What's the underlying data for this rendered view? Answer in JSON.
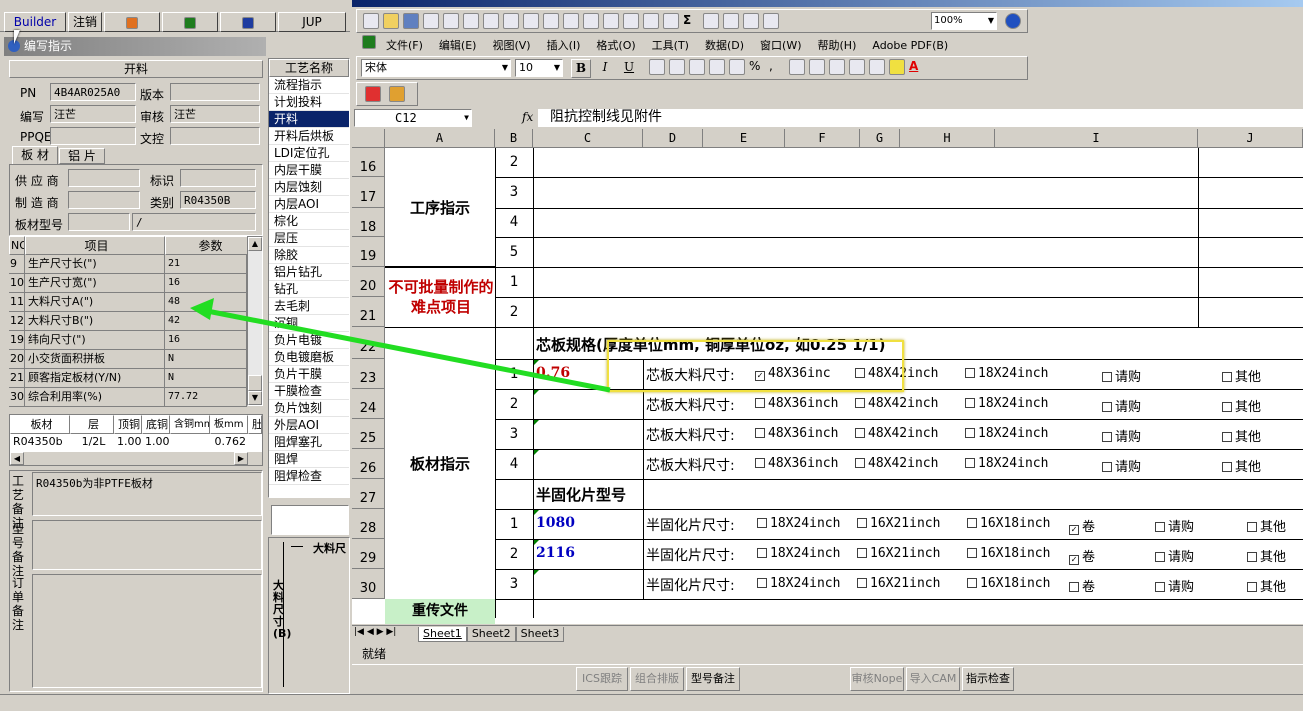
{
  "left_panel": {
    "toolbar_buttons": [
      "Builder",
      "注销",
      "JUP"
    ],
    "window_title": "编写指示",
    "group_title": "开料",
    "fields": [
      {
        "label": "PN",
        "value": "4B4AR025A0"
      },
      {
        "label": "版本",
        "value": ""
      },
      {
        "label": "编写",
        "value": "汪芒"
      },
      {
        "label": "审核",
        "value": "汪芒"
      },
      {
        "label": "PPQE",
        "value": ""
      },
      {
        "label": "文控",
        "value": ""
      }
    ],
    "tabs": [
      "板 材",
      "铝 片"
    ],
    "material_fields": [
      {
        "label": "供 应 商",
        "value": ""
      },
      {
        "label": "标识",
        "value": ""
      },
      {
        "label": "制 造 商",
        "value": ""
      },
      {
        "label": "类别",
        "value": "R04350B"
      },
      {
        "label": "板材型号",
        "value": "",
        "value2": "/"
      }
    ],
    "params_table": {
      "headers": [
        "NO",
        "项目",
        "参数"
      ],
      "rows": [
        [
          "9",
          "生产尺寸长(\")",
          "21"
        ],
        [
          "10",
          "生产尺寸宽(\")",
          "16"
        ],
        [
          "11",
          "大料尺寸A(\")",
          "48"
        ],
        [
          "12",
          "大料尺寸B(\")",
          "42"
        ],
        [
          "19",
          "纬向尺寸(\")",
          "16"
        ],
        [
          "20",
          "小交货面积拼板",
          "N"
        ],
        [
          "21",
          "顾客指定板材(Y/N)",
          "N"
        ],
        [
          "30",
          "综合利用率(%)",
          "77.72"
        ]
      ]
    },
    "board_table": {
      "headers": [
        "板材",
        "层",
        "顶铜",
        "底铜",
        "含铜mm",
        "板mm",
        "肚"
      ],
      "rows": [
        [
          "R04350b",
          "1/2L",
          "1.00",
          "1.00",
          "",
          "0.762",
          ""
        ]
      ]
    },
    "remarks": [
      {
        "label": "工艺备注",
        "value": "R04350b为非PTFE板材"
      },
      {
        "label": "型号备注",
        "value": ""
      },
      {
        "label": "订单备注",
        "value": ""
      }
    ]
  },
  "process_list": {
    "header": "工艺名称",
    "items": [
      "流程指示",
      "计划投料",
      "开料",
      "开料后烘板",
      "LDI定位孔",
      "内层干膜",
      "内层蚀刻",
      "内层AOI",
      "棕化",
      "层压",
      "除胶",
      "铝片钻孔",
      "钻孔",
      "去毛刺",
      "沉铜",
      "负片电镀",
      "负电镀磨板",
      "负片干膜",
      "干膜检查",
      "负片蚀刻",
      "外层AOI",
      "阻焊塞孔",
      "阻焊",
      "阻焊检查"
    ],
    "selected": "开料"
  },
  "drawing": {
    "label1": "大料尺",
    "label2": "大料尺寸(B)"
  },
  "excel": {
    "menus": [
      "文件(F)",
      "编辑(E)",
      "视图(V)",
      "插入(I)",
      "格式(O)",
      "工具(T)",
      "数据(D)",
      "窗口(W)",
      "帮助(H)",
      "Adobe PDF(B)"
    ],
    "font_name": "宋体",
    "font_size": "10",
    "zoom": "100%",
    "name_box": "C12",
    "formula": "阻抗控制线见附件",
    "columns": [
      "A",
      "B",
      "C",
      "D",
      "E",
      "F",
      "G",
      "H",
      "I",
      "J"
    ],
    "rows": [
      "16",
      "17",
      "18",
      "19",
      "20",
      "21",
      "22",
      "23",
      "24",
      "25",
      "26",
      "27",
      "28",
      "29",
      "30"
    ],
    "section_process": "工序指示",
    "section_hard": "不可批量制作的难点项目",
    "section_board": "板材指示",
    "section_reupload": "重传文件",
    "b_numbers": [
      "2",
      "3",
      "4",
      "5",
      "1",
      "2"
    ],
    "core_header": "芯板规格(厚度单位mm, 铜厚单位oz, 如0.25 1/1)",
    "core_rows": [
      {
        "no": "1",
        "value": "0.76",
        "label": "芯板大料尺寸:",
        "opts": [
          {
            "t": "48X36inc",
            "c": true
          },
          {
            "t": "48X42inch",
            "c": false
          },
          {
            "t": "18X24inch",
            "c": false
          },
          {
            "t": "请购",
            "c": false
          },
          {
            "t": "其他",
            "c": false
          }
        ]
      },
      {
        "no": "2",
        "value": "",
        "label": "芯板大料尺寸:",
        "opts": [
          {
            "t": "48X36inch",
            "c": false
          },
          {
            "t": "48X42inch",
            "c": false
          },
          {
            "t": "18X24inch",
            "c": false
          },
          {
            "t": "请购",
            "c": false
          },
          {
            "t": "其他",
            "c": false
          }
        ]
      },
      {
        "no": "3",
        "value": "",
        "label": "芯板大料尺寸:",
        "opts": [
          {
            "t": "48X36inch",
            "c": false
          },
          {
            "t": "48X42inch",
            "c": false
          },
          {
            "t": "18X24inch",
            "c": false
          },
          {
            "t": "请购",
            "c": false
          },
          {
            "t": "其他",
            "c": false
          }
        ]
      },
      {
        "no": "4",
        "value": "",
        "label": "芯板大料尺寸:",
        "opts": [
          {
            "t": "48X36inch",
            "c": false
          },
          {
            "t": "48X42inch",
            "c": false
          },
          {
            "t": "18X24inch",
            "c": false
          },
          {
            "t": "请购",
            "c": false
          },
          {
            "t": "其他",
            "c": false
          }
        ]
      }
    ],
    "prepreg_header": "半固化片型号",
    "prepreg_rows": [
      {
        "no": "1",
        "value": "1080",
        "label": "半固化片尺寸:",
        "opts": [
          {
            "t": "18X24inch",
            "c": false
          },
          {
            "t": "16X21inch",
            "c": false
          },
          {
            "t": "16X18inch",
            "c": false
          },
          {
            "t": "卷",
            "c": true
          },
          {
            "t": "请购",
            "c": false
          },
          {
            "t": "其他",
            "c": false
          }
        ]
      },
      {
        "no": "2",
        "value": "2116",
        "label": "半固化片尺寸:",
        "opts": [
          {
            "t": "18X24inch",
            "c": false
          },
          {
            "t": "16X21inch",
            "c": false
          },
          {
            "t": "16X18inch",
            "c": false
          },
          {
            "t": "卷",
            "c": true
          },
          {
            "t": "请购",
            "c": false
          },
          {
            "t": "其他",
            "c": false
          }
        ]
      },
      {
        "no": "3",
        "value": "",
        "label": "半固化片尺寸:",
        "opts": [
          {
            "t": "18X24inch",
            "c": false
          },
          {
            "t": "16X21inch",
            "c": false
          },
          {
            "t": "16X18inch",
            "c": false
          },
          {
            "t": "卷",
            "c": false
          },
          {
            "t": "请购",
            "c": false
          },
          {
            "t": "其他",
            "c": false
          }
        ]
      }
    ],
    "sheets": [
      "Sheet1",
      "Sheet2",
      "Sheet3"
    ],
    "status": "就绪"
  },
  "bottom_buttons": [
    "ICS跟踪",
    "组合排版",
    "型号备注",
    "审核Nope",
    "导入CAM",
    "指示检查"
  ],
  "colors": {
    "red": "#c00000",
    "blue": "#0000c0",
    "green_arrow": "#22dd22",
    "highlight": "#f0e040",
    "selected": "#0a246a"
  }
}
